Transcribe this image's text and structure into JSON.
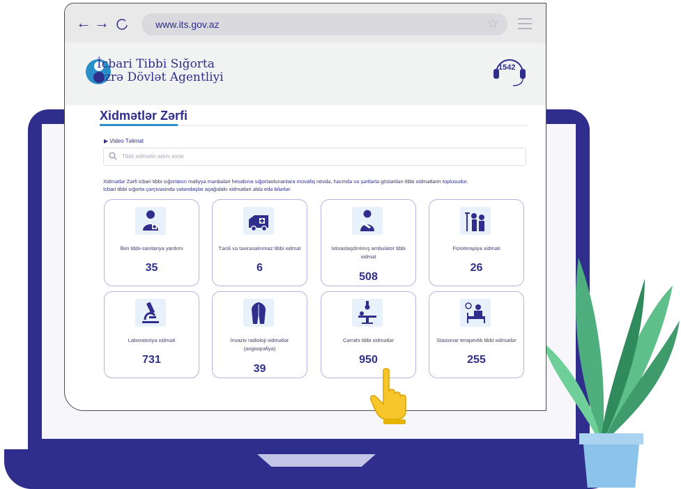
{
  "browser": {
    "url": "www.its.gov.az",
    "back_glyph": "←",
    "forward_glyph": "→",
    "star_glyph": "☆"
  },
  "header": {
    "logo_line1": "İcbari Tibbi Sığorta",
    "logo_line2": "üzrə Dövlət Agentliyi",
    "hotline": "1542"
  },
  "main": {
    "title": "Xidmətlər Zərfi",
    "video_link": "Video Təlimat",
    "search_placeholder": "Tibbi xidmətin adını axtar",
    "description_line1": "Xidmətlər Zərfi icbari tibbi sığortanın maliyyə mənbələri hesabına sığortaolunanlara müvafiq növdə, həcmdə və şərtlərlə göstərilən tibbi xidmətlərin toplusudur.",
    "description_line2": "İcbari tibbi sığorta çərçivəsində vətəndaşlar aşağıdakı xidmətləri əldə edə bilərlər:"
  },
  "cards": [
    {
      "label": "İlkin tibbi-sanitariya yardımı",
      "count": "35",
      "icon": "doctor-icon"
    },
    {
      "label": "Təcili və təxirəsalınmaz tibbi xidmət",
      "count": "6",
      "icon": "ambulance-icon"
    },
    {
      "label": "İxtisaslaşdırılmış ambulator tibbi xidmət",
      "count": "508",
      "icon": "patient-icon"
    },
    {
      "label": "Fizioterapiya xidməti",
      "count": "26",
      "icon": "physiotherapy-icon"
    },
    {
      "label": "Laboratoriya xidməti",
      "count": "731",
      "icon": "microscope-icon"
    },
    {
      "label": "İnvaziv radioloji xidmətlər (angioqrafiya)",
      "count": "39",
      "icon": "angiography-icon"
    },
    {
      "label": "Cərrahi tibbi xidmətlər",
      "count": "950",
      "icon": "surgery-icon"
    },
    {
      "label": "Stasionar terapevtik tibbi xidmətlər",
      "count": "255",
      "icon": "hospital-bed-icon"
    }
  ],
  "colors": {
    "brand": "#2f2e8c",
    "accent": "#2a8fc8",
    "card_border": "#b6b4de",
    "hand": "#f7c62c",
    "leaf": "#5fbf8a",
    "pot": "#8cc3ea"
  }
}
